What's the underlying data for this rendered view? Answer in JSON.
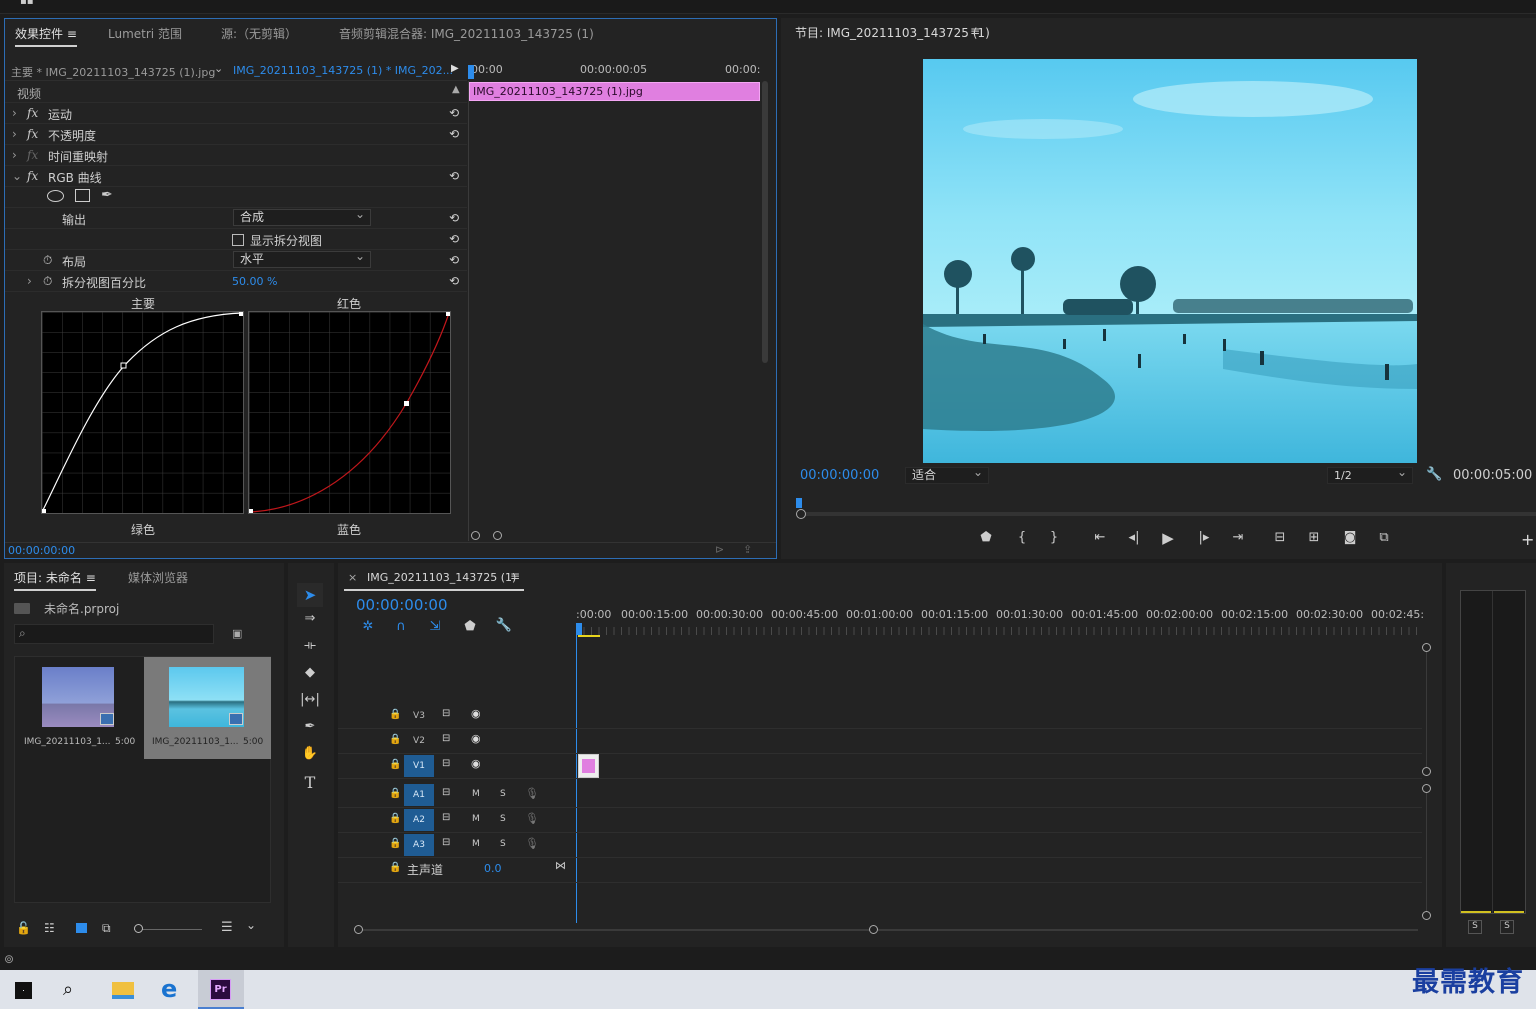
{
  "effect_controls": {
    "tabs": [
      "效果控件",
      "Lumetri 范围",
      "源:（无剪辑）",
      "音频剪辑混合器: IMG_20211103_143725 (1)"
    ],
    "menu_icon": "≡",
    "source_label": "主要 * IMG_20211103_143725 (1).jpg",
    "sequence_label": "IMG_20211103_143725 (1) * IMG_202...",
    "time_start": "00:00",
    "time_mid": "00:00:00:05",
    "time_end": "00:00:",
    "clip_name": "IMG_20211103_143725 (1).jpg",
    "section_video": "视频",
    "effects": [
      {
        "name": "运动"
      },
      {
        "name": "不透明度"
      },
      {
        "name": "时间重映射"
      },
      {
        "name": "RGB 曲线"
      }
    ],
    "output_label": "输出",
    "output_value": "合成",
    "split_view_label": "显示拆分视图",
    "layout_label": "布局",
    "layout_value": "水平",
    "split_pct_label": "拆分视图百分比",
    "split_pct_value": "50.00 %",
    "curve_master": "主要",
    "curve_red": "红色",
    "curve_green": "绿色",
    "curve_blue": "蓝色",
    "timecode": "00:00:00:00",
    "colors": {
      "clip": "#e07fe0",
      "red_curve": "#c0171b"
    }
  },
  "program_monitor": {
    "title": "节目: IMG_20211103_143725 (1)",
    "menu_icon": "≡",
    "timecode": "00:00:00:00",
    "fit_value": "适合",
    "resolution": "1/2",
    "duration": "00:00:05:00",
    "controls": [
      "marker-icon",
      "in-point-icon",
      "out-point-icon",
      "go-to-in-icon",
      "step-back-icon",
      "play-icon",
      "step-forward-icon",
      "go-to-out-icon",
      "lift-icon",
      "extract-icon",
      "export-frame-icon",
      "compare-icon"
    ]
  },
  "project": {
    "tabs": [
      "项目: 未命名",
      "媒体浏览器"
    ],
    "menu_icon": "≡",
    "file_name": "未命名.prproj",
    "items": [
      {
        "name": "IMG_20211103_1...",
        "duration": "5:00"
      },
      {
        "name": "IMG_20211103_1...",
        "duration": "5:00"
      }
    ]
  },
  "timeline": {
    "close": "×",
    "title": "IMG_20211103_143725 (1)",
    "menu_icon": "≡",
    "timecode": "00:00:00:00",
    "ruler": [
      ":00:00",
      "00:00:15:00",
      "00:00:30:00",
      "00:00:45:00",
      "00:01:00:00",
      "00:01:15:00",
      "00:01:30:00",
      "00:01:45:00",
      "00:02:00:00",
      "00:02:15:00",
      "00:02:30:00",
      "00:02:45:"
    ],
    "video_tracks": [
      "V3",
      "V2",
      "V1"
    ],
    "audio_tracks": [
      "A1",
      "A2",
      "A3"
    ],
    "mute": "M",
    "solo": "S",
    "master_label": "主声道",
    "master_value": "0.0"
  },
  "audio_meter": {
    "buttons": [
      "S",
      "S"
    ]
  },
  "watermark": "最需教育",
  "taskbar": {
    "app_label": "Pr"
  }
}
